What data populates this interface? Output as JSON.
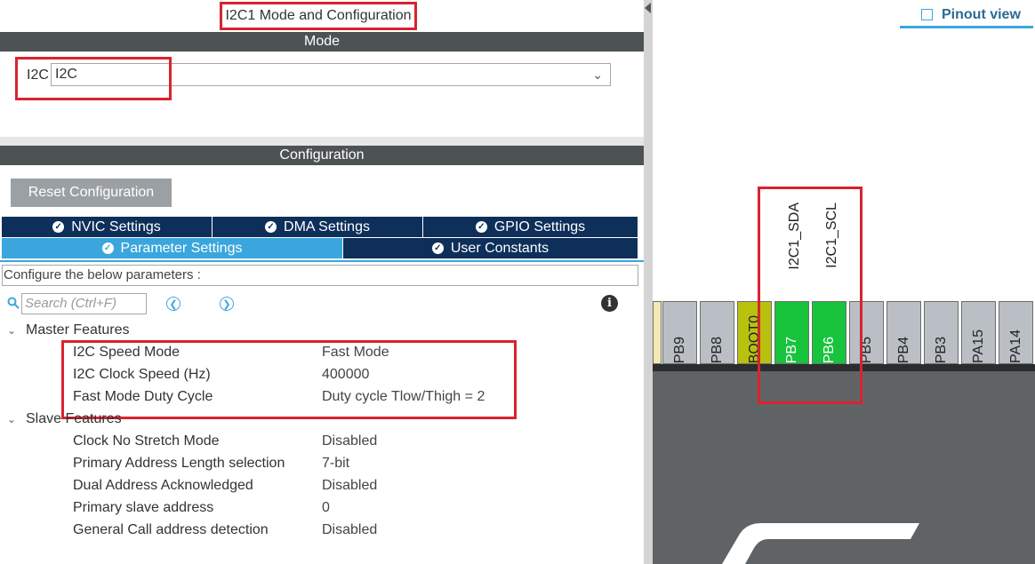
{
  "panel_title": "I2C1 Mode and Configuration",
  "mode": {
    "header": "Mode",
    "field_label": "I2C",
    "field_value": "I2C"
  },
  "configuration": {
    "header": "Configuration",
    "reset_button": "Reset Configuration",
    "tabs_row1": [
      "NVIC Settings",
      "DMA Settings",
      "GPIO Settings"
    ],
    "tabs_row2": [
      "Parameter Settings",
      "User Constants"
    ],
    "active_tab": "Parameter Settings",
    "instruction": "Configure the below parameters :",
    "search_placeholder": "Search (Ctrl+F)"
  },
  "groups": [
    {
      "name": "Master Features",
      "params": [
        {
          "name": "I2C Speed Mode",
          "value": "Fast Mode"
        },
        {
          "name": "I2C Clock Speed (Hz)",
          "value": "400000"
        },
        {
          "name": "Fast Mode Duty Cycle",
          "value": "Duty cycle Tlow/Thigh = 2"
        }
      ]
    },
    {
      "name": "Slave Features",
      "params": [
        {
          "name": "Clock No Stretch Mode",
          "value": "Disabled"
        },
        {
          "name": "Primary Address Length selection",
          "value": "7-bit"
        },
        {
          "name": "Dual Address Acknowledged",
          "value": "Disabled"
        },
        {
          "name": "Primary slave address",
          "value": "0"
        },
        {
          "name": "General Call address detection",
          "value": "Disabled"
        }
      ]
    }
  ],
  "pinout": {
    "view_label": "Pinout view",
    "pins": [
      "PB9",
      "PB8",
      "BOOT0",
      "PB7",
      "PB6",
      "PB5",
      "PB4",
      "PB3",
      "PA15",
      "PA14"
    ],
    "signals": [
      "I2C1_SDA",
      "I2C1_SCL"
    ],
    "colors": {
      "assigned": "#17c43c",
      "boot": "#b8c20e",
      "default": "#b9bfc4",
      "highlight": "#d9232e",
      "accent": "#3aa6dd",
      "tab_dark": "#0d2f5a"
    }
  }
}
